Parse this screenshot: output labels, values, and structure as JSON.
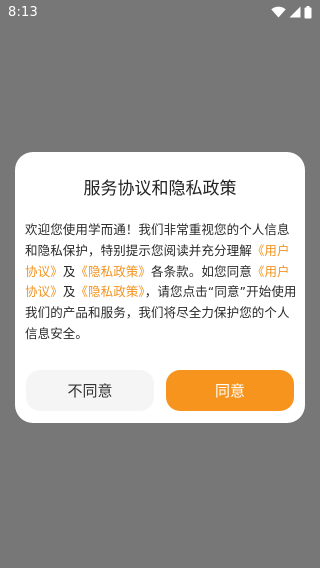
{
  "status_bar": {
    "time": "8:13",
    "icons": [
      "wifi-icon",
      "signal-icon",
      "battery-icon"
    ]
  },
  "dialog": {
    "title": "服务协议和隐私政策",
    "body": {
      "segment_1": "欢迎您使用学而通！我们非常重视您的个人信息和隐私保护，特别提示您阅读并充分理解",
      "link_user_agreement_1": "《用户协议》",
      "segment_2": "及",
      "link_privacy_policy_1": "《隐私政策》",
      "segment_3": "各条款。如您同意",
      "link_user_agreement_2": "《用户协议》",
      "segment_4": "及",
      "link_privacy_policy_2": "《隐私政策》",
      "segment_5": "，请您点击“同意”开始使用我们的产品和服务，我们将尽全力保护您的个人信息安全。"
    },
    "buttons": {
      "disagree_label": "不同意",
      "agree_label": "同意"
    }
  },
  "colors": {
    "overlay_background": "#777777",
    "accent": "#f7941d",
    "link": "#f29422",
    "dialog_background": "#ffffff",
    "secondary_button_background": "#f5f5f5"
  }
}
